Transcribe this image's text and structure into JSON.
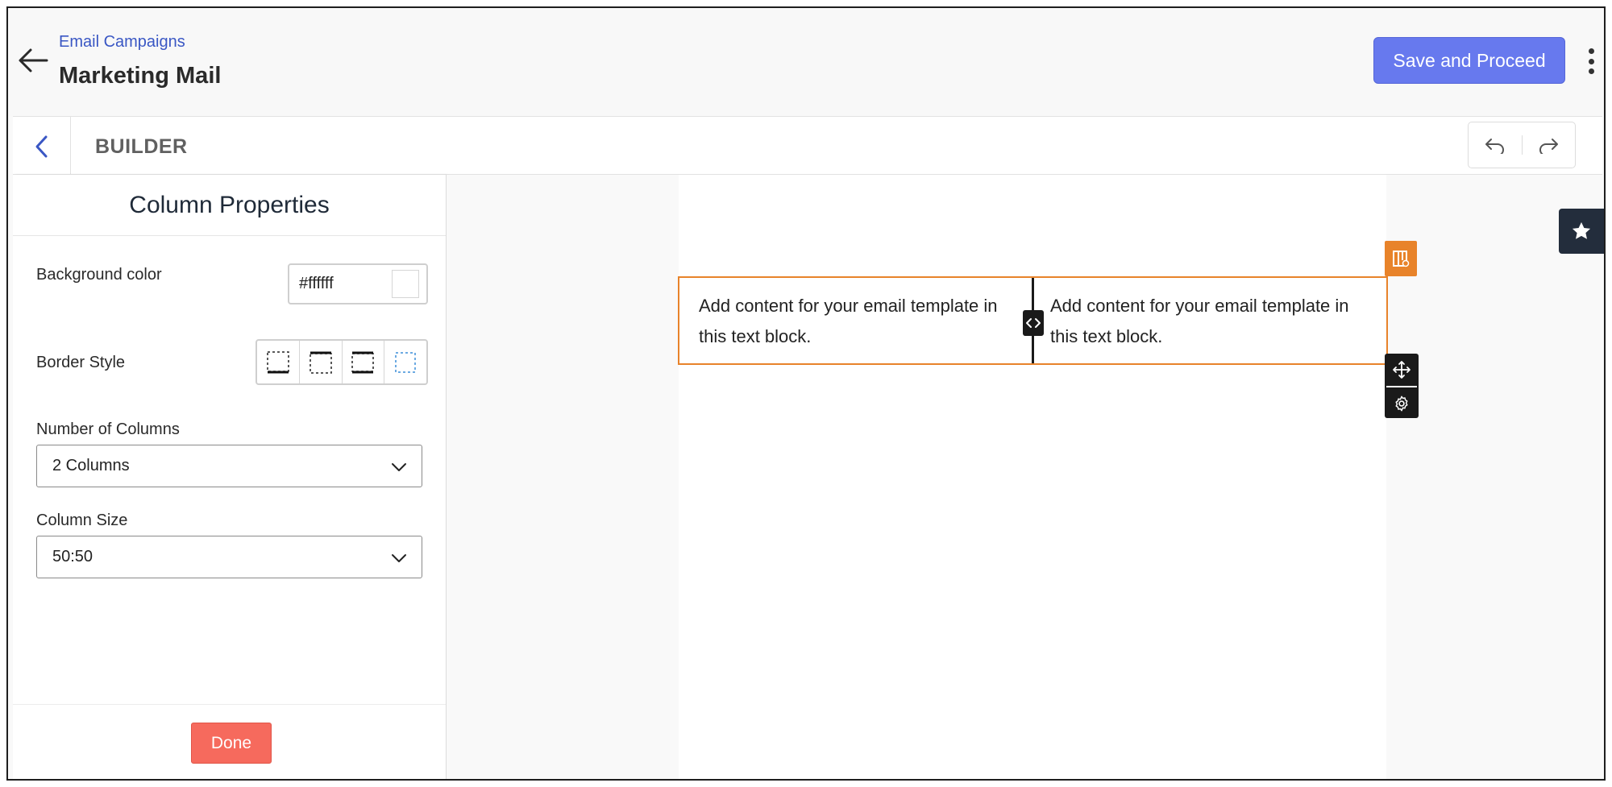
{
  "header": {
    "breadcrumb": "Email Campaigns",
    "title": "Marketing Mail",
    "save_label": "Save and Proceed"
  },
  "builder": {
    "title": "BUILDER"
  },
  "panel": {
    "title": "Column Properties",
    "background_color_label": "Background color",
    "background_color_value": "#ffffff",
    "border_style_label": "Border Style",
    "num_columns_label": "Number of Columns",
    "num_columns_value": "2 Columns",
    "column_size_label": "Column Size",
    "column_size_value": "50:50",
    "done_label": "Done"
  },
  "canvas": {
    "left_column_text": "Add content for your email template in this text block.",
    "right_column_text": "Add content for your email template in this text block."
  },
  "colors": {
    "accent": "#6779ee",
    "selection": "#e8832a",
    "done": "#f66a5d"
  }
}
